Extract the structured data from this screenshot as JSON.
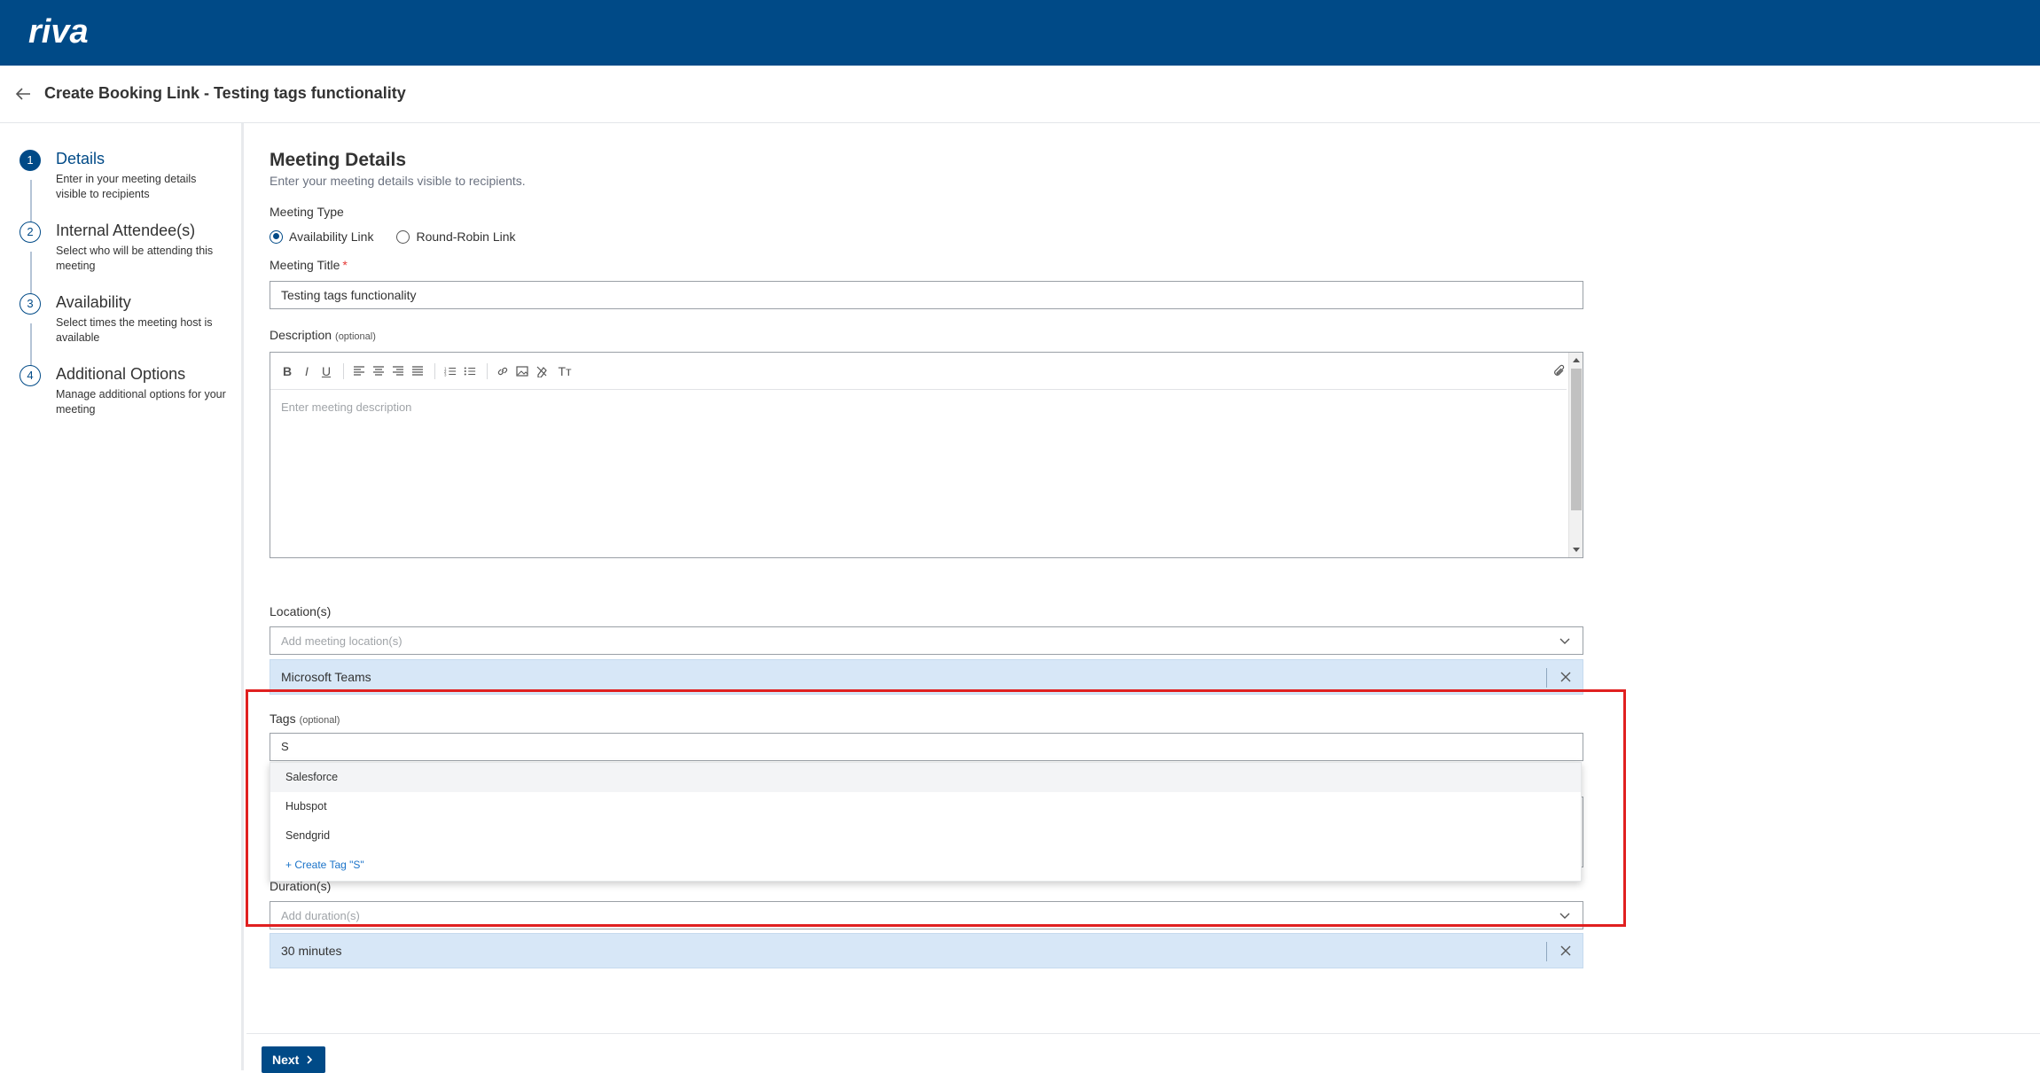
{
  "app": {
    "logo_text": "riva",
    "brand_color": "#004a87",
    "accent_color": "#1a73c9",
    "highlight_color": "#e02020"
  },
  "header": {
    "title": "Create Booking Link - Testing tags functionality",
    "back_icon": "arrow-left-icon"
  },
  "steps": [
    {
      "number": "1",
      "title": "Details",
      "description": "Enter in your meeting details visible to recipients"
    },
    {
      "number": "2",
      "title": "Internal Attendee(s)",
      "description": "Select who will be attending this meeting"
    },
    {
      "number": "3",
      "title": "Availability",
      "description": "Select times the meeting host is available"
    },
    {
      "number": "4",
      "title": "Additional Options",
      "description": "Manage additional options for your meeting"
    }
  ],
  "form": {
    "section_title": "Meeting Details",
    "section_subtitle": "Enter your meeting details visible to recipients.",
    "meeting_type_label": "Meeting Type",
    "meeting_type_options": [
      "Availability Link",
      "Round-Robin Link"
    ],
    "meeting_type_selected": "Availability Link",
    "meeting_title_label": "Meeting Title",
    "meeting_title_required": "*",
    "meeting_title_value": "Testing tags functionality",
    "description_label": "Description",
    "optional_text": "(optional)",
    "description_placeholder": "Enter meeting description",
    "toolbar_icons": [
      "bold-icon",
      "italic-icon",
      "underline-icon",
      "align-left-icon",
      "align-center-icon",
      "align-right-icon",
      "align-justify-icon",
      "ordered-list-icon",
      "bullet-list-icon",
      "link-icon",
      "image-icon",
      "clear-format-icon",
      "text-size-icon",
      "attachment-icon"
    ],
    "toolbar_glyphs": {
      "bold": "B",
      "italic": "I",
      "underline": "U",
      "text_size": "Tт"
    },
    "location_label": "Location(s)",
    "location_placeholder": "Add meeting location(s)",
    "location_selected": "Microsoft Teams",
    "tags_label": "Tags",
    "tags_value": "S",
    "tags_options": [
      "Salesforce",
      "Hubspot",
      "Sendgrid"
    ],
    "tags_create_option": "+ Create Tag \"S\"",
    "duration_label": "Duration(s)",
    "duration_placeholder": "Add duration(s)",
    "duration_selected": "30 minutes"
  },
  "footer": {
    "next_label": "Next"
  }
}
